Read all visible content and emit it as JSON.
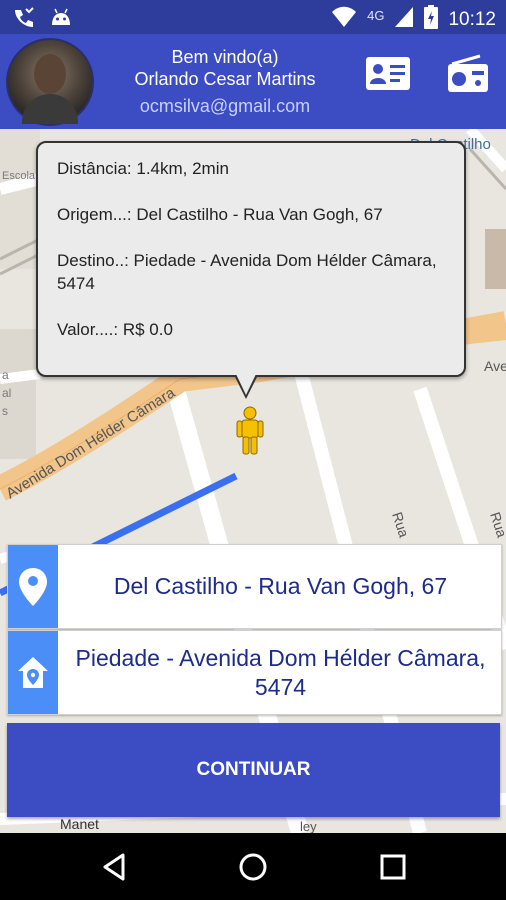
{
  "status_bar": {
    "time": "10:12",
    "network": "4G",
    "icons": [
      "phone-missed-icon",
      "android-icon",
      "wifi-icon",
      "signal-icon",
      "battery-icon"
    ]
  },
  "header": {
    "welcome": "Bem vindo(a)",
    "user_name": "Orlando Cesar Martins",
    "email": "ocmsilva@gmail.com",
    "icons": [
      "id-card-icon",
      "radio-icon"
    ]
  },
  "map": {
    "street_labels": [
      "Avenida Dom Hélder Câmara",
      "Del Castilho",
      "Ave",
      "Rua",
      "Rua",
      "Manet",
      "Escola Municipal Dom",
      "a",
      "al",
      "s",
      "ley"
    ]
  },
  "callout": {
    "distance": "Distância: 1.4km, 2min",
    "origin": "Origem...: Del Castilho - Rua Van Gogh, 67",
    "destination": "Destino..: Piedade - Avenida Dom Hélder Câmara, 5474",
    "value": "Valor....: R$ 0.0"
  },
  "origin_field": {
    "icon": "location-pin-icon",
    "text": "Del Castilho - Rua Van Gogh, 67"
  },
  "destination_field": {
    "icon": "home-location-icon",
    "text": "Piedade - Avenida Dom Hélder Câmara, 5474"
  },
  "continue_button": {
    "label": "CONTINUAR"
  },
  "colors": {
    "primary": "#3c4cc2",
    "status_bar": "#2e3d9c",
    "field_icon_bg": "#4c8ef7",
    "field_text": "#1d2b8a"
  }
}
